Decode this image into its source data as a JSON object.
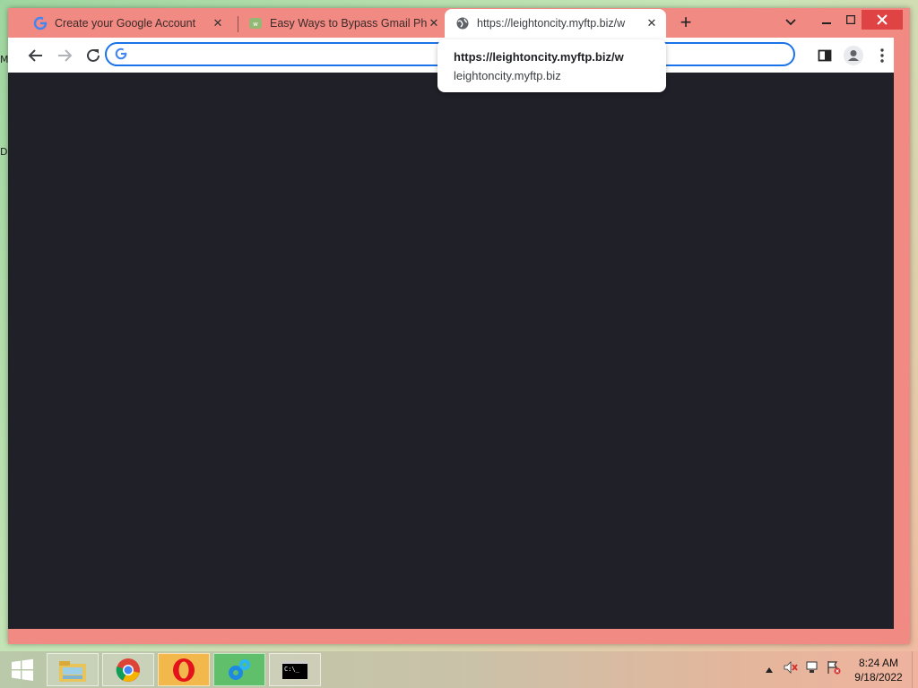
{
  "desktop": {
    "left_letters": [
      "M",
      "D"
    ]
  },
  "browser": {
    "tabs": [
      {
        "title": "Create your Google Account",
        "icon": "google-g-icon",
        "active": false
      },
      {
        "title": "Easy Ways to Bypass Gmail Phon",
        "icon": "wikihow-icon",
        "active": false
      },
      {
        "title": "https://leightoncity.myftp.biz/w",
        "icon": "globe-icon",
        "active": true
      }
    ],
    "new_tab_label": "+",
    "omnibox": {
      "value": "",
      "placeholder": ""
    },
    "hovercard": {
      "url": "https://leightoncity.myftp.biz/w",
      "domain": "leightoncity.myftp.biz"
    },
    "content_bg": "#1f2028",
    "frame_color": "#f08a82",
    "accent": "#1a73e8"
  },
  "taskbar": {
    "apps": [
      "windows-start-icon",
      "file-explorer-icon",
      "chrome-icon",
      "opera-icon",
      "settings-gears-icon",
      "command-prompt-icon"
    ],
    "clock": {
      "time": "8:24 AM",
      "date": "9/18/2022"
    },
    "cmd_label": "C:\\_"
  }
}
